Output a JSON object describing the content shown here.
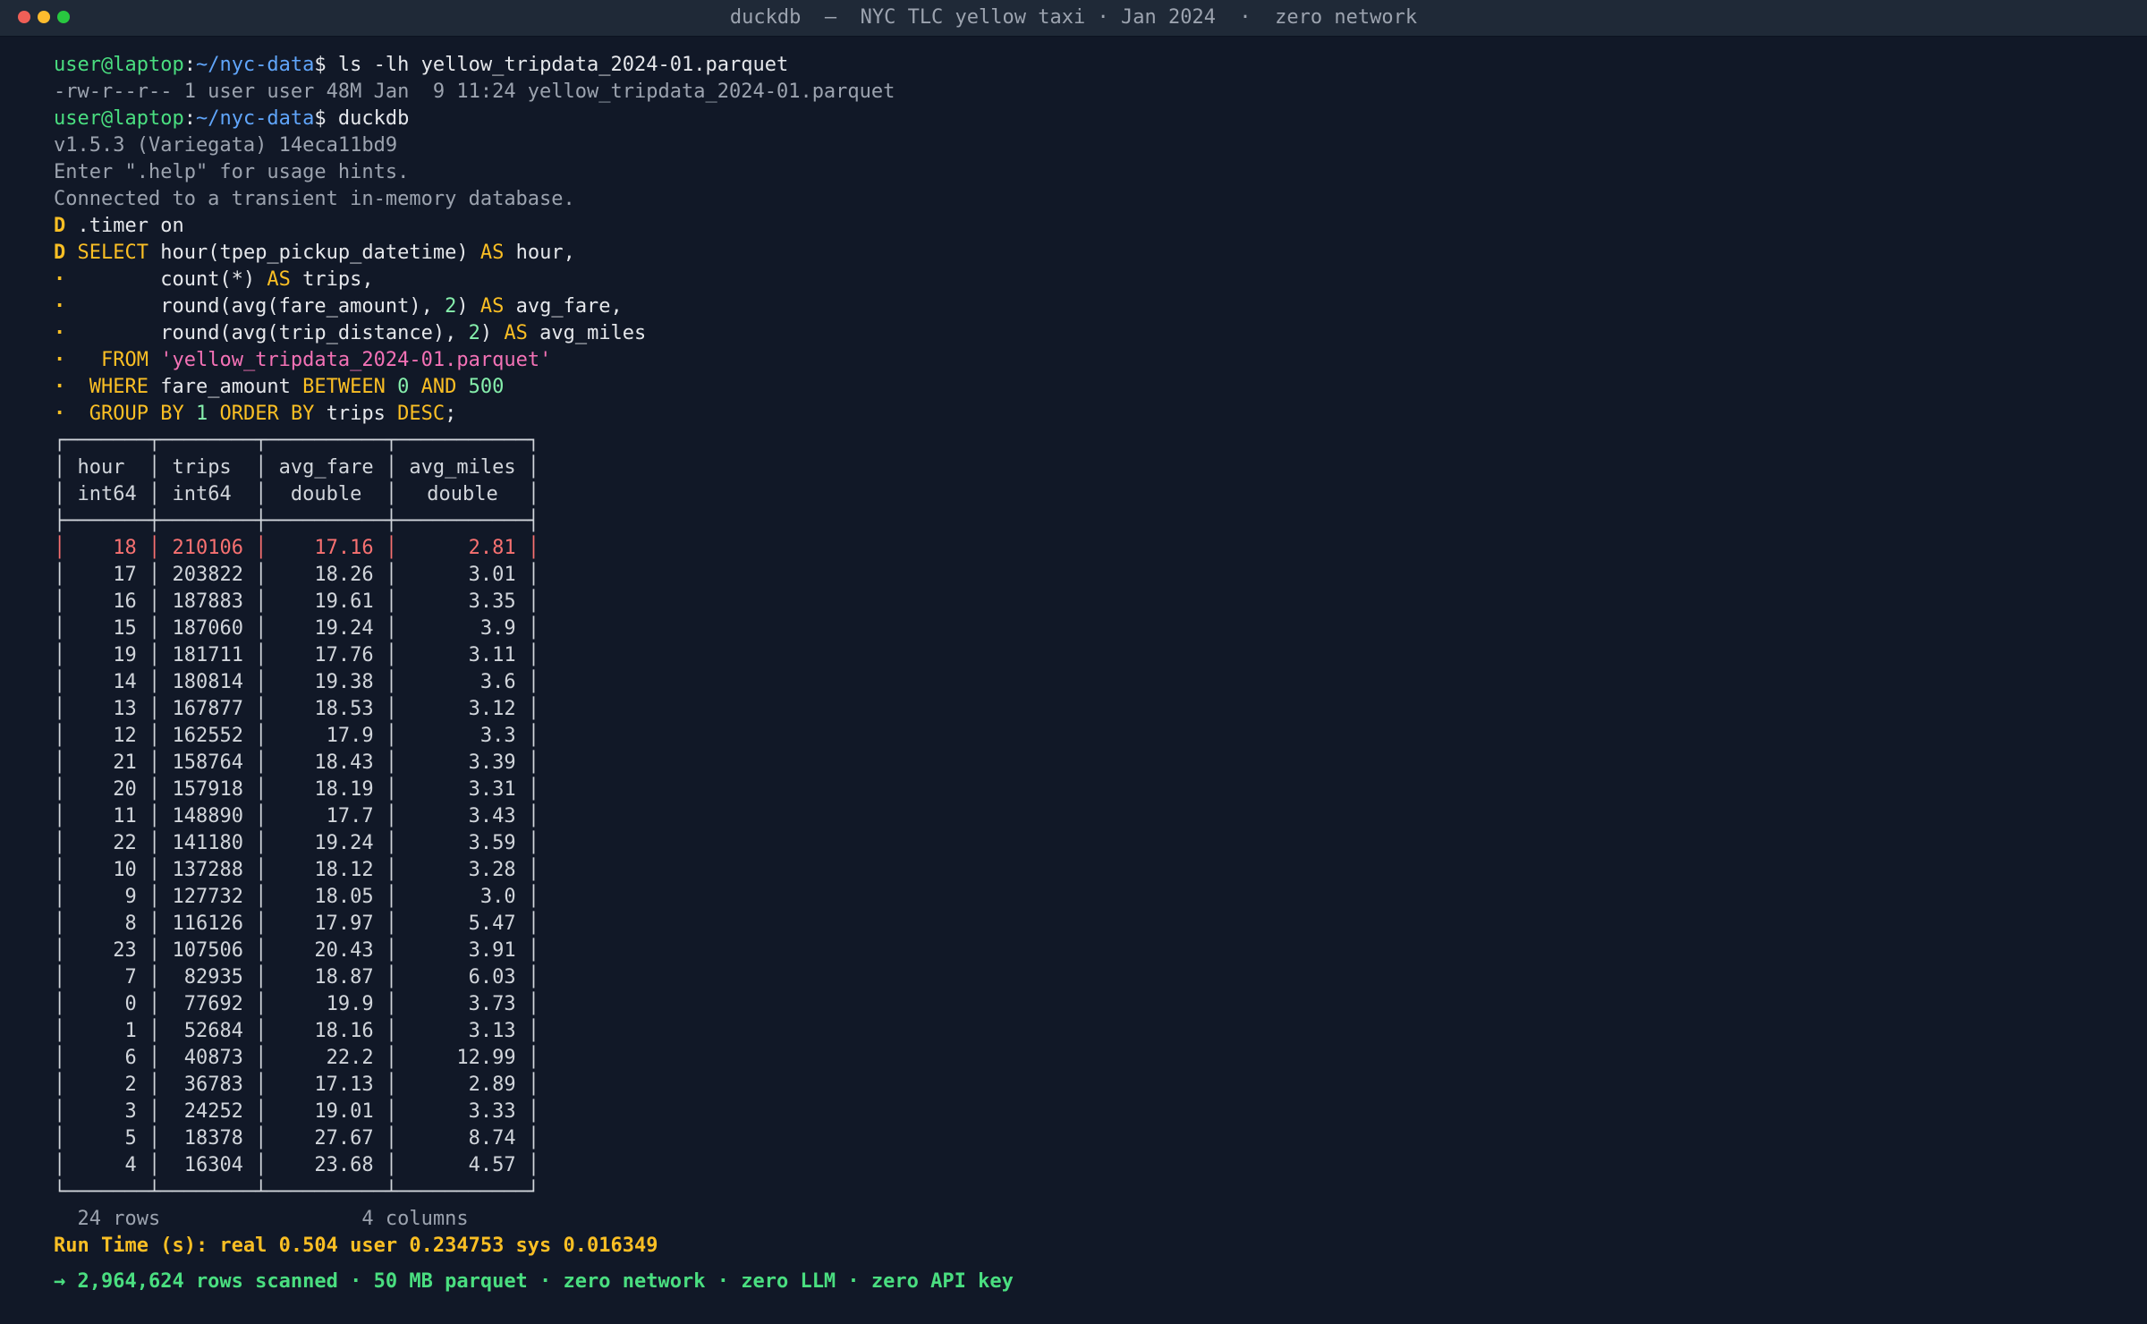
{
  "window": {
    "title": "duckdb  —  NYC TLC yellow taxi · Jan 2024  ·  zero network",
    "light_colors": [
      "#ef5f57",
      "#febc2e",
      "#28c840"
    ]
  },
  "session": {
    "user_host": "user@laptop",
    "path": "~/nyc-data",
    "prompt_symbol": "$",
    "cmd_ls": " ls -lh yellow_tripdata_2024-01.parquet",
    "ls_output": "-rw-r--r-- 1 user user 48M Jan  9 11:24 yellow_tripdata_2024-01.parquet",
    "cmd_duckdb": " duckdb",
    "version": "v1.5.3 (Variegata) 14eca11bd9",
    "help_hint": "Enter \".help\" for usage hints.",
    "connected": "Connected to a transient in-memory database.",
    "duck_prompt": "D",
    "cont_prompt": "·",
    "timer_cmd": " .timer on"
  },
  "sql": {
    "select_kw": "SELECT",
    "hour_expr": " hour(tpep_pickup_datetime) ",
    "as_kw": "AS",
    "hour_alias": " hour,",
    "count_expr": "        count(*) ",
    "trips_alias": " trips,",
    "round_fare_a": "        round(avg(fare_amount), ",
    "two": "2",
    "round_close": ") ",
    "fare_alias": " avg_fare,",
    "round_miles_a": "        round(avg(trip_distance), ",
    "miles_alias": " avg_miles",
    "from_kw": "FROM",
    "from_file": "'yellow_tripdata_2024-01.parquet'",
    "where_kw": "WHERE",
    "where_col": " fare_amount ",
    "between_kw": "BETWEEN",
    "zero": "0",
    "and_kw": "AND",
    "five_hundred": "500",
    "group_kw": "GROUP BY",
    "one": "1",
    "order_kw": "ORDER BY",
    "order_col": " trips ",
    "desc_kw": "DESC",
    "semicolon": ";"
  },
  "result": {
    "columns": [
      {
        "name": "hour",
        "type": "int64"
      },
      {
        "name": "trips",
        "type": "int64"
      },
      {
        "name": "avg_fare",
        "type": "double"
      },
      {
        "name": "avg_miles",
        "type": "double"
      }
    ],
    "rows": [
      [
        "18",
        "210106",
        "17.16",
        "2.81"
      ],
      [
        "17",
        "203822",
        "18.26",
        "3.01"
      ],
      [
        "16",
        "187883",
        "19.61",
        "3.35"
      ],
      [
        "15",
        "187060",
        "19.24",
        "3.9"
      ],
      [
        "19",
        "181711",
        "17.76",
        "3.11"
      ],
      [
        "14",
        "180814",
        "19.38",
        "3.6"
      ],
      [
        "13",
        "167877",
        "18.53",
        "3.12"
      ],
      [
        "12",
        "162552",
        "17.9",
        "3.3"
      ],
      [
        "21",
        "158764",
        "18.43",
        "3.39"
      ],
      [
        "20",
        "157918",
        "18.19",
        "3.31"
      ],
      [
        "11",
        "148890",
        "17.7",
        "3.43"
      ],
      [
        "22",
        "141180",
        "19.24",
        "3.59"
      ],
      [
        "10",
        "137288",
        "18.12",
        "3.28"
      ],
      [
        "9",
        "127732",
        "18.05",
        "3.0"
      ],
      [
        "8",
        "116126",
        "17.97",
        "5.47"
      ],
      [
        "23",
        "107506",
        "20.43",
        "3.91"
      ],
      [
        "7",
        "82935",
        "18.87",
        "6.03"
      ],
      [
        "0",
        "77692",
        "19.9",
        "3.73"
      ],
      [
        "1",
        "52684",
        "18.16",
        "3.13"
      ],
      [
        "6",
        "40873",
        "22.2",
        "12.99"
      ],
      [
        "2",
        "36783",
        "17.13",
        "2.89"
      ],
      [
        "3",
        "24252",
        "19.01",
        "3.33"
      ],
      [
        "5",
        "18378",
        "27.67",
        "8.74"
      ],
      [
        "4",
        "16304",
        "23.68",
        "4.57"
      ]
    ],
    "highlight_row": 0,
    "row_count": "24 rows",
    "col_count": "4 columns"
  },
  "footer": {
    "runtime": "Run Time (s): real 0.504 user 0.234753 sys 0.016349",
    "summary": "→ 2,964,624 rows scanned · 50 MB parquet · zero network · zero LLM · zero API key"
  },
  "colors": {
    "background": "#111827",
    "prompt_user": "#4ade80",
    "prompt_path": "#60a5fa",
    "keyword": "#fbbf24",
    "string": "#f472b6",
    "highlight": "#f87171",
    "summary": "#4ade80"
  }
}
